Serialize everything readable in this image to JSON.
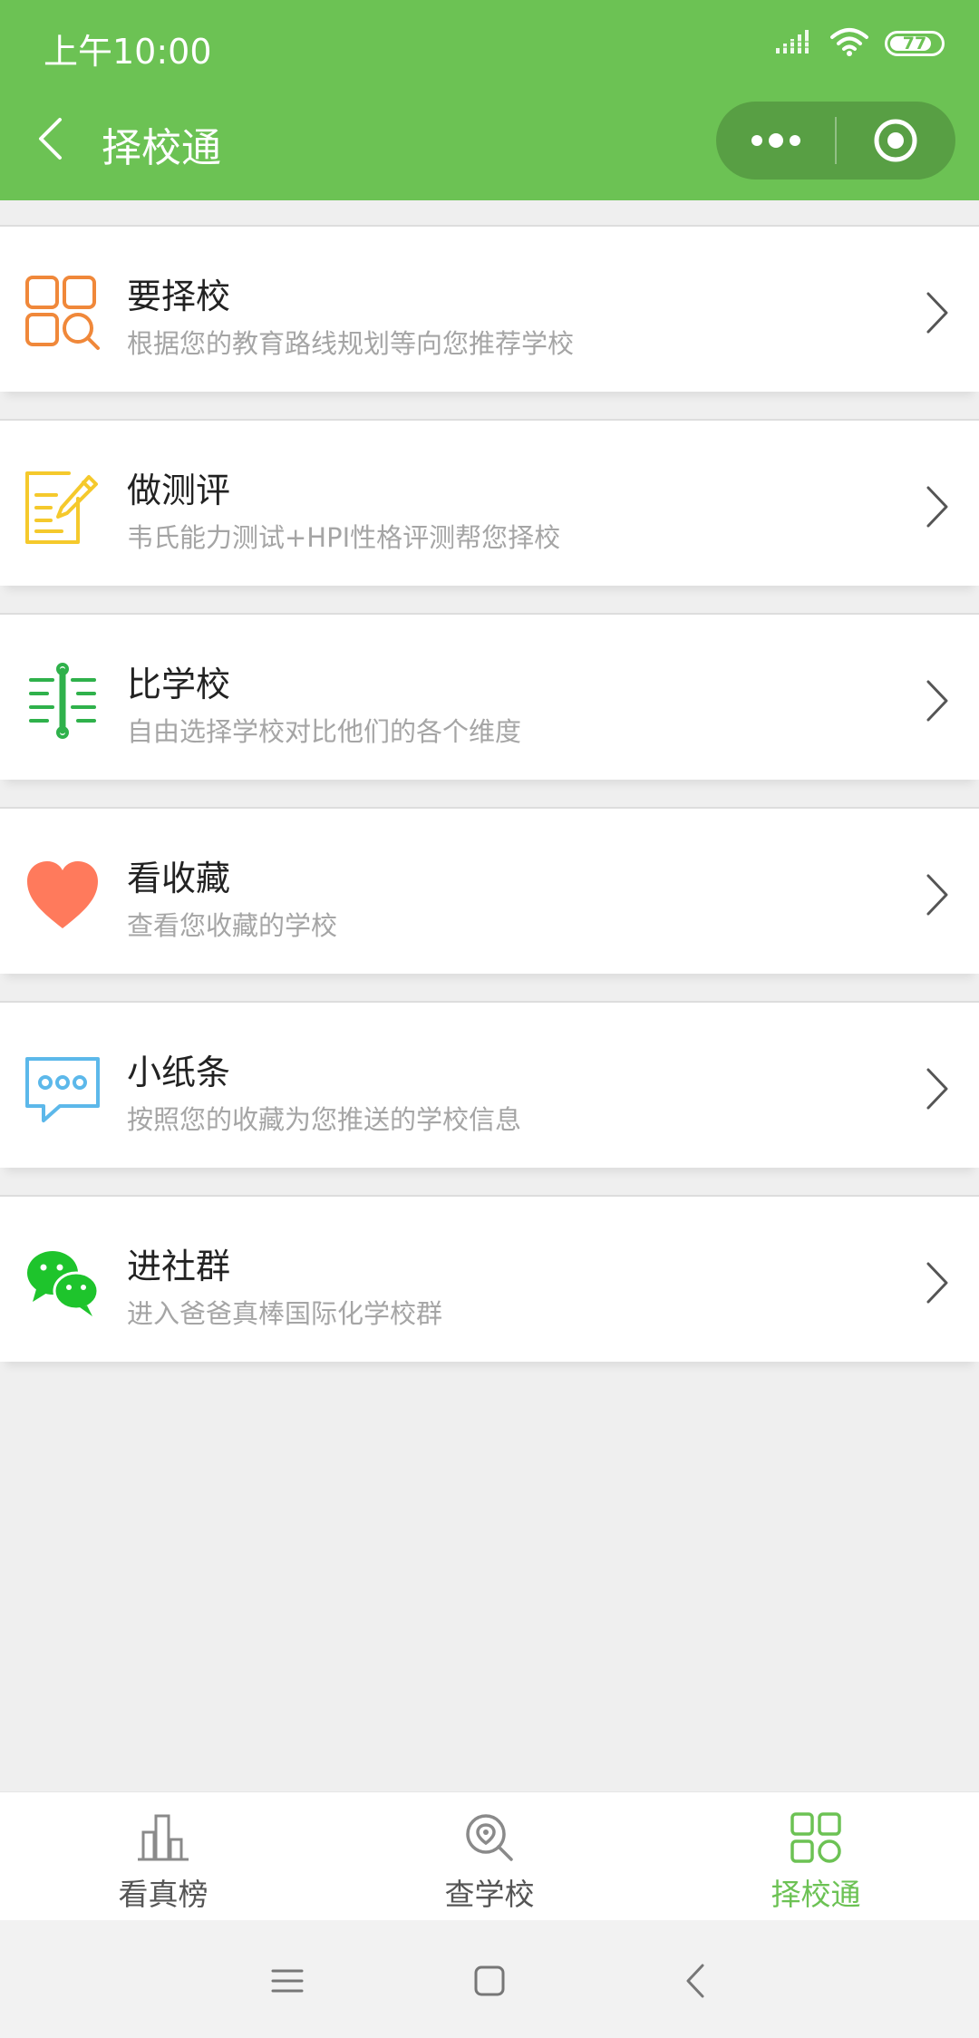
{
  "status_bar": {
    "time": "上午10:00",
    "battery": "77"
  },
  "nav": {
    "title": "择校通"
  },
  "menu": [
    {
      "title": "要择校",
      "subtitle": "根据您的教育路线规划等向您推荐学校",
      "icon": "grid-search-icon",
      "color": "#f0883a"
    },
    {
      "title": "做测评",
      "subtitle": "韦氏能力测试+HPI性格评测帮您择校",
      "icon": "document-pen-icon",
      "color": "#f5c92c"
    },
    {
      "title": "比学校",
      "subtitle": "自由选择学校对比他们的各个维度",
      "icon": "compare-icon",
      "color": "#2fb14b"
    },
    {
      "title": "看收藏",
      "subtitle": "查看您收藏的学校",
      "icon": "heart-icon",
      "color": "#ff7a5c"
    },
    {
      "title": "小纸条",
      "subtitle": "按照您的收藏为您推送的学校信息",
      "icon": "message-icon",
      "color": "#5cb8ea"
    },
    {
      "title": "进社群",
      "subtitle": "进入爸爸真棒国际化学校群",
      "icon": "wechat-icon",
      "color": "#1ec42c"
    }
  ],
  "tabbar": [
    {
      "label": "看真榜",
      "icon": "ranking-icon",
      "active": false
    },
    {
      "label": "查学校",
      "icon": "search-school-icon",
      "active": false
    },
    {
      "label": "择校通",
      "icon": "apps-icon",
      "active": true
    }
  ],
  "colors": {
    "brand": "#6cc254",
    "background": "#efefef",
    "subtitle": "#a5a5a5"
  }
}
